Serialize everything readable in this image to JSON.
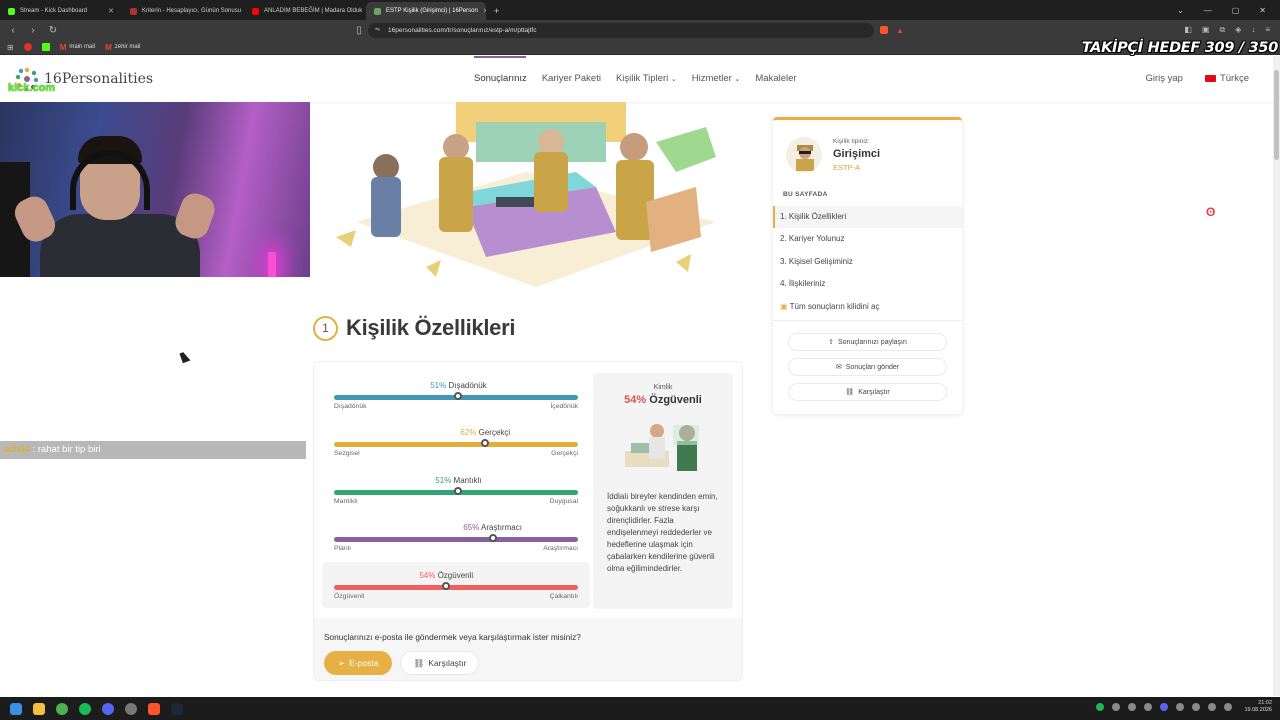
{
  "browser": {
    "tabs": [
      {
        "label": "Stream - Kick Dashboard",
        "color": "#53fc18",
        "active": false
      },
      {
        "label": "Kriterin - Hesaplayıcı, Günün Sonusu",
        "color": "#b0302f",
        "active": false
      },
      {
        "label": "ANLADIM BEBEĞİM | Madara Olduk",
        "color": "#ff0000",
        "active": false
      },
      {
        "label": "ESTP Kişilik (Girişimci) | 16Person",
        "color": "#6aa46b",
        "active": true
      }
    ],
    "url": "16personalities.com/tr/sonuçlarınız/estp-a/m/pttajtfc",
    "bookmarks": [
      "main mail",
      "zehir mail"
    ]
  },
  "stream_overlay": {
    "follower_goal": "TAKİPÇİ HEDEF 309 / 350",
    "chat_user": "ach94",
    "chat_sep": " : ",
    "chat_message": "rahat bir tip biri",
    "brand": "kick.com"
  },
  "site": {
    "logo": "16Personalities",
    "nav": [
      "Sonuçlarınız",
      "Kariyer Paketi",
      "Kişilik Tipleri",
      "Hizmetler",
      "Makaleler"
    ],
    "login": "Giriş yap",
    "language": "Türkçe"
  },
  "section": {
    "number": "1",
    "title": "Kişilik Özellikleri"
  },
  "traits": [
    {
      "pct": "51%",
      "name": "Dışadönük",
      "left": "Dışadönük",
      "right": "İçedönük",
      "value": 51,
      "color": "#4298b4"
    },
    {
      "pct": "62%",
      "name": "Gerçekçi",
      "left": "Sezgisel",
      "right": "Gerçekçi",
      "value": 62,
      "color": "#e4ae3a"
    },
    {
      "pct": "51%",
      "name": "Mantıklı",
      "left": "Mantıklı",
      "right": "Duygusal",
      "value": 51,
      "color": "#33a474"
    },
    {
      "pct": "65%",
      "name": "Araştırmacı",
      "left": "Planlı",
      "right": "Araştırmacı",
      "value": 65,
      "color": "#88619a"
    },
    {
      "pct": "54%",
      "name": "Özgüvenli",
      "left": "Özgüvenli",
      "right": "Çalkantılı",
      "value": 46,
      "color": "#f25e62"
    }
  ],
  "trait_panel": {
    "kicker": "Kimlik",
    "pct": "54%",
    "name": "Özgüvenli",
    "description": "İddialı bireyler kendinden emin, soğukkanlı ve strese karşı dirençlidirler. Fazla endişelenmeyi reddederler ve hedeflerine ulaşmak için çabalarken kendilerine güvenli olma eğilimindedirler."
  },
  "share": {
    "question": "Sonuçlarınızı e-posta ile göndermek veya karşılaştırmak ister misiniz?",
    "email": "E-posta",
    "compare": "Karşılaştır"
  },
  "type_card": {
    "kicker": "Kişilik tipiniz:",
    "name": "Girişimci",
    "code": "ESTP-A",
    "on_page": "BU SAYFADA",
    "items": [
      "1. Kişilik Özellikleri",
      "2. Kariyer Yolunuz",
      "3. Kişisel Gelişiminiz",
      "4. İlişkileriniz",
      "Tüm sonuçların kilidini aç"
    ],
    "share": "Sonuçlarınızı paylaşın",
    "send": "Sonuçları gönder",
    "compare": "Karşılaştır"
  },
  "clock": {
    "time": "21:02",
    "date": "19.08.2026"
  }
}
